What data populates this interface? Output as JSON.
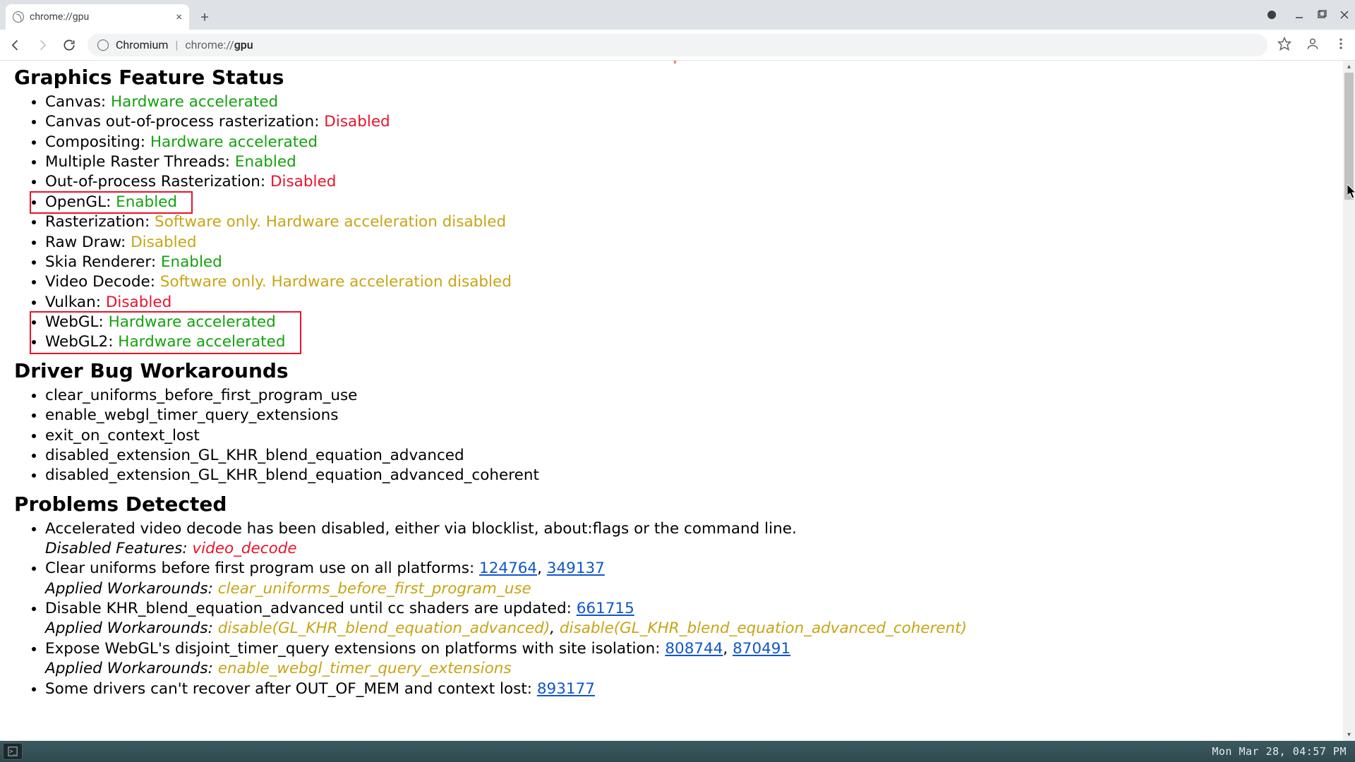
{
  "tab": {
    "title": "chrome://gpu"
  },
  "omnibox": {
    "origin_label": "Chromium",
    "url_text": "chrome://gpu"
  },
  "sections": {
    "gfs_heading": "Graphics Feature Status",
    "dbw_heading": "Driver Bug Workarounds",
    "pd_heading": "Problems Detected"
  },
  "features": [
    {
      "label": "Canvas",
      "status": "Hardware accelerated",
      "cls": "green"
    },
    {
      "label": "Canvas out-of-process rasterization",
      "status": "Disabled",
      "cls": "red"
    },
    {
      "label": "Compositing",
      "status": "Hardware accelerated",
      "cls": "green"
    },
    {
      "label": "Multiple Raster Threads",
      "status": "Enabled",
      "cls": "green"
    },
    {
      "label": "Out-of-process Rasterization",
      "status": "Disabled",
      "cls": "red"
    },
    {
      "label": "OpenGL",
      "status": "Enabled",
      "cls": "green"
    },
    {
      "label": "Rasterization",
      "status": "Software only. Hardware acceleration disabled",
      "cls": "yellow"
    },
    {
      "label": "Raw Draw",
      "status": "Disabled",
      "cls": "yellow"
    },
    {
      "label": "Skia Renderer",
      "status": "Enabled",
      "cls": "green"
    },
    {
      "label": "Video Decode",
      "status": "Software only. Hardware acceleration disabled",
      "cls": "yellow"
    },
    {
      "label": "Vulkan",
      "status": "Disabled",
      "cls": "red"
    },
    {
      "label": "WebGL",
      "status": "Hardware accelerated",
      "cls": "green"
    },
    {
      "label": "WebGL2",
      "status": "Hardware accelerated",
      "cls": "green"
    }
  ],
  "workarounds": [
    "clear_uniforms_before_first_program_use",
    "enable_webgl_timer_query_extensions",
    "exit_on_context_lost",
    "disabled_extension_GL_KHR_blend_equation_advanced",
    "disabled_extension_GL_KHR_blend_equation_advanced_coherent"
  ],
  "problems": [
    {
      "desc": "Accelerated video decode has been disabled, either via blocklist, about:flags or the command line.",
      "note_label": "Disabled Features:",
      "note_value": "video_decode",
      "note_cls": "red",
      "links": []
    },
    {
      "desc": "Clear uniforms before first program use on all platforms:",
      "links": [
        "124764",
        "349137"
      ],
      "note_label": "Applied Workarounds:",
      "note_value": "clear_uniforms_before_first_program_use",
      "note_cls": "yellow"
    },
    {
      "desc": "Disable KHR_blend_equation_advanced until cc shaders are updated:",
      "links": [
        "661715"
      ],
      "note_label": "Applied Workarounds:",
      "note_value": "disable(GL_KHR_blend_equation_advanced), disable(GL_KHR_blend_equation_advanced_coherent)",
      "note_cls": "yellow"
    },
    {
      "desc": "Expose WebGL's disjoint_timer_query extensions on platforms with site isolation:",
      "links": [
        "808744",
        "870491"
      ],
      "note_label": "Applied Workarounds:",
      "note_value": "enable_webgl_timer_query_extensions",
      "note_cls": "yellow"
    },
    {
      "desc": "Some drivers can't recover after OUT_OF_MEM and context lost:",
      "links": [
        "893177"
      ],
      "note_label": "",
      "note_value": "",
      "note_cls": ""
    }
  ],
  "taskbar": {
    "clock": "Mon Mar 28, 04:57 PM"
  }
}
